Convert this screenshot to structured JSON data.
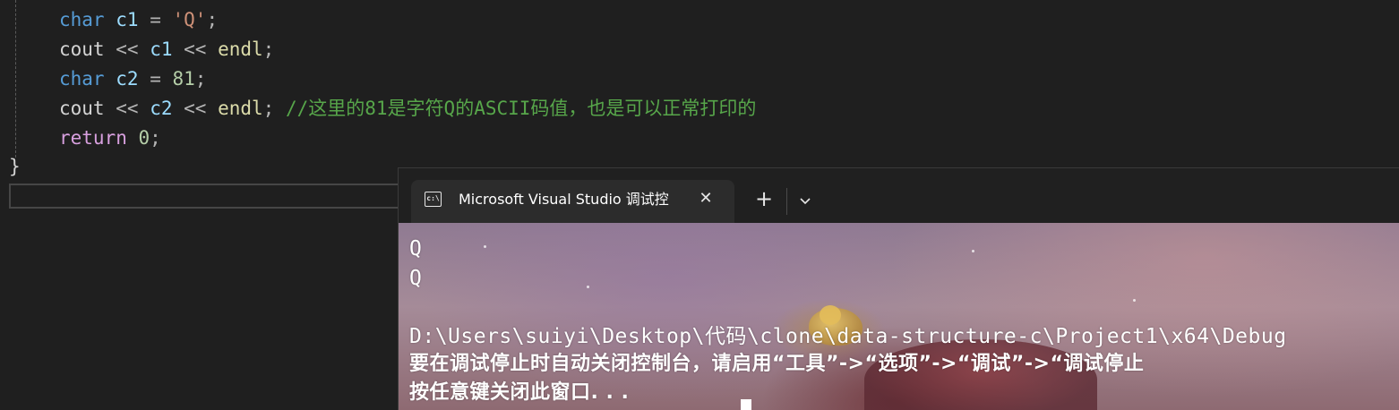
{
  "editor": {
    "line1": {
      "kw": "char",
      "var": "c1",
      "eq": "=",
      "str": "'Q'",
      "end": ";"
    },
    "line2": {
      "fn": "cout",
      "op1": "<<",
      "var": "c1",
      "op2": "<<",
      "endl": "endl",
      "end": ";"
    },
    "line3": {
      "kw": "char",
      "var": "c2",
      "eq": "=",
      "num": "81",
      "end": ";"
    },
    "line4": {
      "fn": "cout",
      "op1": "<<",
      "var": "c2",
      "op2": "<<",
      "endl": "endl",
      "end": ";",
      "comment": "//这里的81是字符Q的ASCII码值，也是可以正常打印的"
    },
    "line5": {
      "kw": "return",
      "num": "0",
      "end": ";"
    },
    "closing_brace": "}"
  },
  "terminal": {
    "tab_icon": "c:\\",
    "tab_title": "Microsoft Visual Studio 调试控",
    "tab_close": "✕",
    "new_tab": "+",
    "output": {
      "line1": "Q",
      "line2": "Q",
      "path_line": "D:\\Users\\suiyi\\Desktop\\代码\\clone\\data-structure-c\\Project1\\x64\\Debug",
      "hint_line": "要在调试停止时自动关闭控制台，请启用“工具”->“选项”->“调试”->“调试停止",
      "close_line": "按任意键关闭此窗口. . ."
    }
  },
  "colors": {
    "editor_bg": "#1f1f1f",
    "keyword": "#569cd6",
    "variable": "#9cdcfe",
    "string": "#ce9178",
    "number": "#b5cea8",
    "function": "#dcdcaa",
    "comment": "#57a64a"
  },
  "icons": [
    "console-app-icon",
    "close-icon",
    "plus-icon",
    "chevron-down-icon"
  ]
}
